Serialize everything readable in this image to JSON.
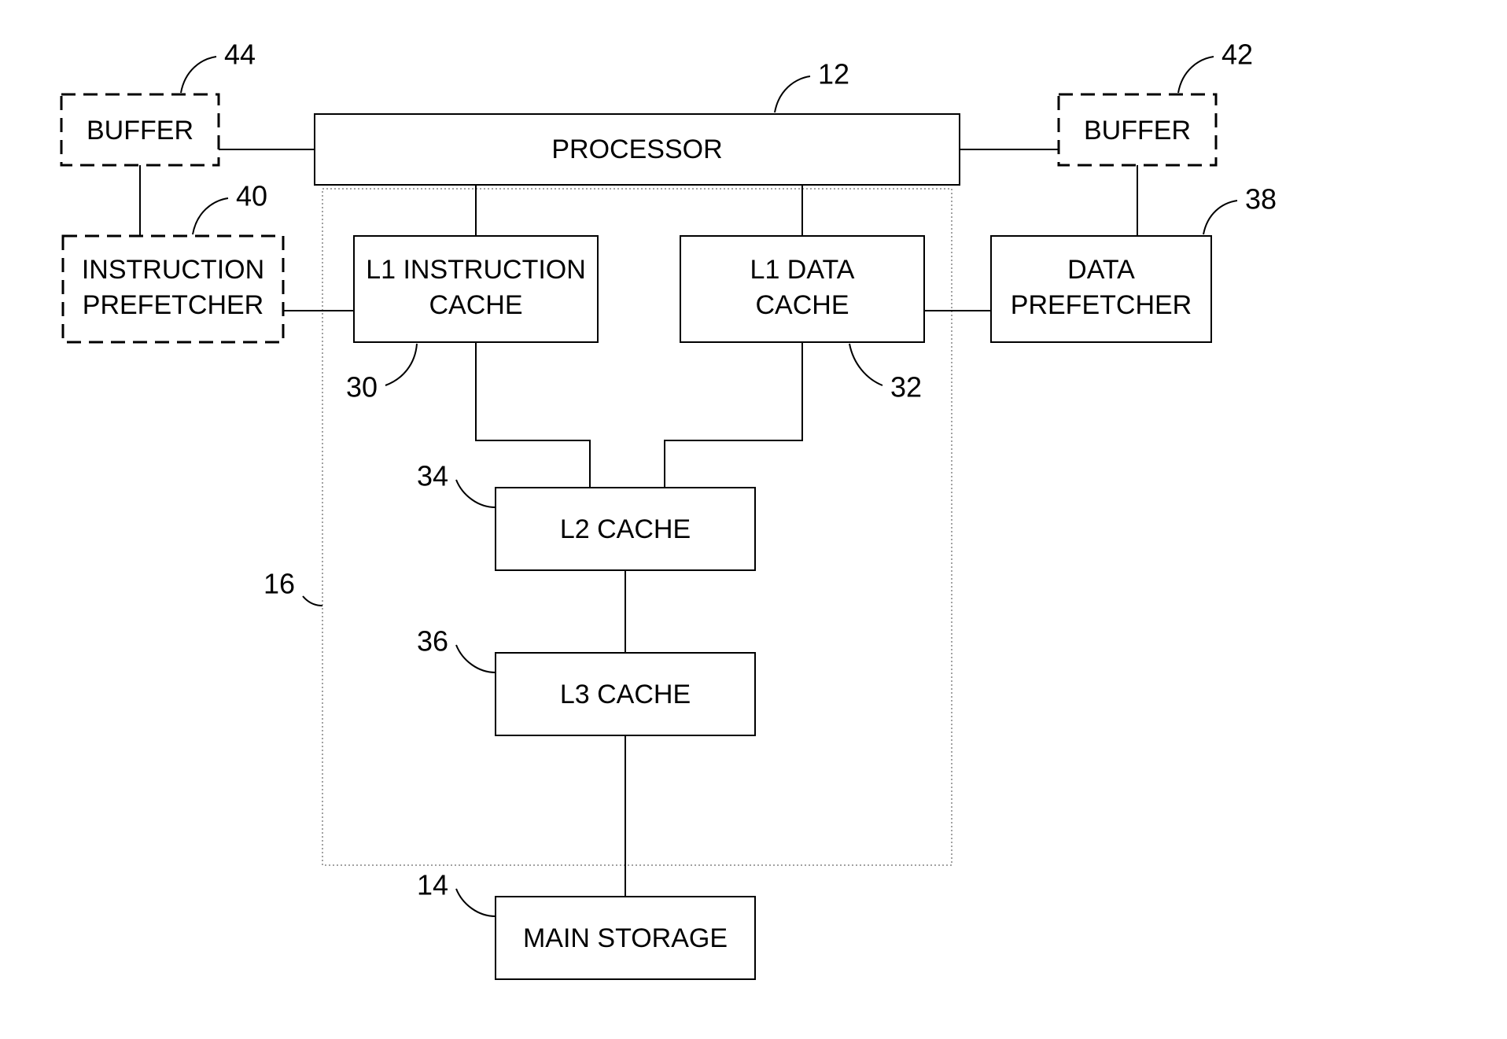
{
  "blocks": {
    "processor": {
      "label": "PROCESSOR",
      "ref": "12"
    },
    "buffer_left": {
      "label": "BUFFER",
      "ref": "44"
    },
    "buffer_right": {
      "label": "BUFFER",
      "ref": "42"
    },
    "instr_prefetch": {
      "line1": "INSTRUCTION",
      "line2": "PREFETCHER",
      "ref": "40"
    },
    "data_prefetch": {
      "line1": "DATA",
      "line2": "PREFETCHER",
      "ref": "38"
    },
    "l1i": {
      "line1": "L1 INSTRUCTION",
      "line2": "CACHE",
      "ref": "30"
    },
    "l1d": {
      "line1": "L1 DATA",
      "line2": "CACHE",
      "ref": "32"
    },
    "l2": {
      "label": "L2 CACHE",
      "ref": "34"
    },
    "l3": {
      "label": "L3 CACHE",
      "ref": "36"
    },
    "main_storage": {
      "label": "MAIN STORAGE",
      "ref": "14"
    },
    "cache_group": {
      "ref": "16"
    }
  }
}
